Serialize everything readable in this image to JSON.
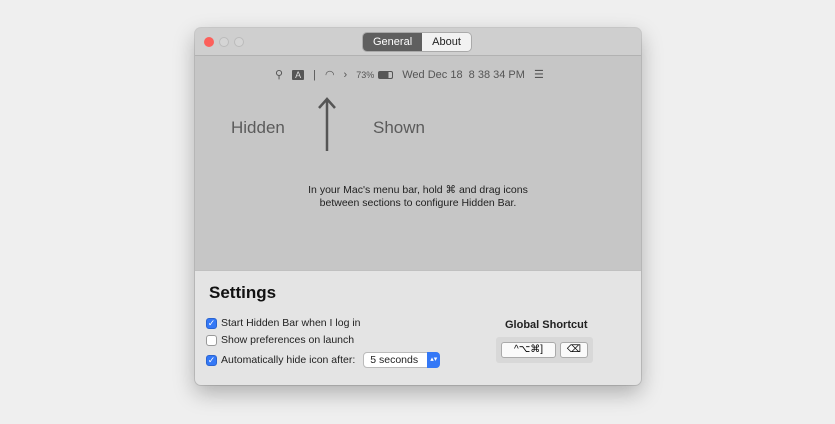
{
  "tabs": [
    "General",
    "About"
  ],
  "menubar": {
    "battery": "73%",
    "clock": "Wed Dec 18  8 38 34 PM",
    "icons": [
      "search-icon",
      "input-source-icon",
      "separator-icon",
      "wifi-icon",
      "chevron-right-icon",
      "battery-icon",
      "list-icon"
    ],
    "input_letter": "A"
  },
  "labels": {
    "hidden": "Hidden",
    "shown": "Shown"
  },
  "instructions": [
    "In your Mac's menu bar, hold ⌘ and drag icons",
    "between sections to configure Hidden Bar."
  ],
  "settings": {
    "title": "Settings",
    "start_login": "Start Hidden Bar when I log in",
    "show_prefs": "Show preferences on launch",
    "auto_hide": "Automatically hide icon after:",
    "auto_hide_value": "5 seconds",
    "global_shortcut": "Global Shortcut",
    "shortcut": "^⌥⌘]",
    "clear": "⌫"
  },
  "colors": {
    "accent": "#3478f6",
    "close": "#fc605b"
  }
}
